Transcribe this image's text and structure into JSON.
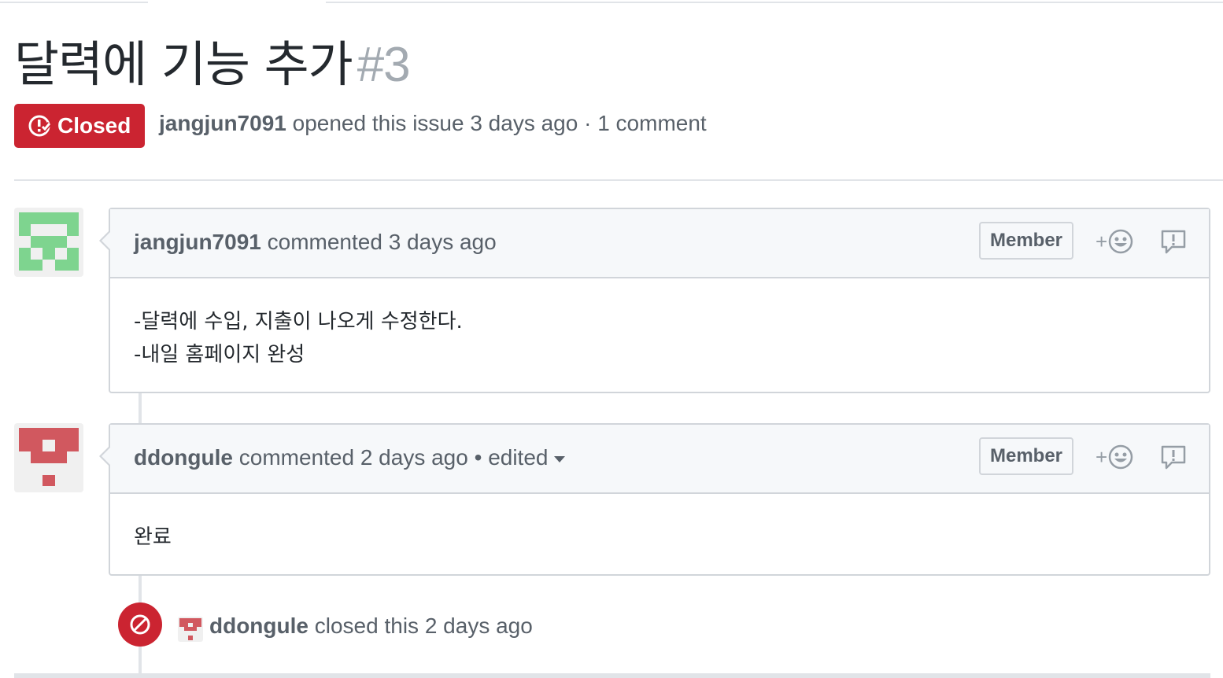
{
  "issue": {
    "title": "달력에 기능 추가",
    "number": "#3",
    "state": "Closed",
    "author": "jangjun7091",
    "opened_text": "opened this issue 3 days ago · 1 comment"
  },
  "comments": [
    {
      "author": "jangjun7091",
      "action": "commented 3 days ago",
      "edited": "",
      "badge": "Member",
      "body": [
        "-달력에 수입, 지출이 나오게 수정한다.",
        "-내일 홈페이지 완성"
      ]
    },
    {
      "author": "ddongule",
      "action": "commented 2 days ago • edited",
      "badge": "Member",
      "body": [
        "완료"
      ]
    }
  ],
  "event": {
    "actor": "ddongule",
    "text": "closed this 2 days ago"
  },
  "colors": {
    "closed_red": "#cb2431",
    "avatar_green": "#7ed48f",
    "avatar_red": "#d1585f",
    "border": "#d1d5da",
    "header_bg": "#f6f8fa"
  },
  "icons": [
    "issue-closed-icon",
    "smiley-icon",
    "report-icon",
    "circle-slash-icon",
    "caret-down-icon"
  ]
}
